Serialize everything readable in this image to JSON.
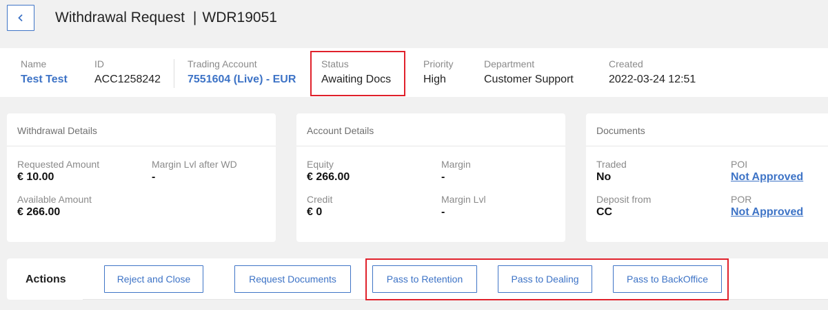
{
  "header": {
    "title": "Withdrawal Request",
    "separator": "|",
    "request_id": "WDR19051"
  },
  "info": {
    "name_label": "Name",
    "name_value": "Test Test",
    "id_label": "ID",
    "id_value": "ACC1258242",
    "trading_label": "Trading Account",
    "trading_value": "7551604 (Live) - EUR",
    "status_label": "Status",
    "status_value": "Awaiting Docs",
    "priority_label": "Priority",
    "priority_value": "High",
    "department_label": "Department",
    "department_value": "Customer Support",
    "created_label": "Created",
    "created_value": "2022-03-24 12:51"
  },
  "withdrawal": {
    "title": "Withdrawal Details",
    "requested_label": "Requested Amount",
    "requested_value": "€ 10.00",
    "margin_after_label": "Margin Lvl after WD",
    "margin_after_value": "-",
    "available_label": "Available Amount",
    "available_value": "€ 266.00"
  },
  "account": {
    "title": "Account Details",
    "equity_label": "Equity",
    "equity_value": "€ 266.00",
    "margin_label": "Margin",
    "margin_value": "-",
    "credit_label": "Credit",
    "credit_value": "€ 0",
    "margin_lvl_label": "Margin Lvl",
    "margin_lvl_value": "-"
  },
  "documents": {
    "title": "Documents",
    "traded_label": "Traded",
    "traded_value": "No",
    "poi_label": "POI",
    "poi_value": "Not Approved",
    "deposit_label": "Deposit from",
    "deposit_value": "CC",
    "por_label": "POR",
    "por_value": "Not Approved"
  },
  "actions": {
    "label": "Actions",
    "reject": "Reject and Close",
    "request_docs": "Request Documents",
    "retention": "Pass to Retention",
    "dealing": "Pass to Dealing",
    "backoffice": "Pass to BackOffice"
  },
  "colors": {
    "accent": "#3d73c6",
    "highlight": "#e0202a",
    "background": "#f1f1f1"
  }
}
